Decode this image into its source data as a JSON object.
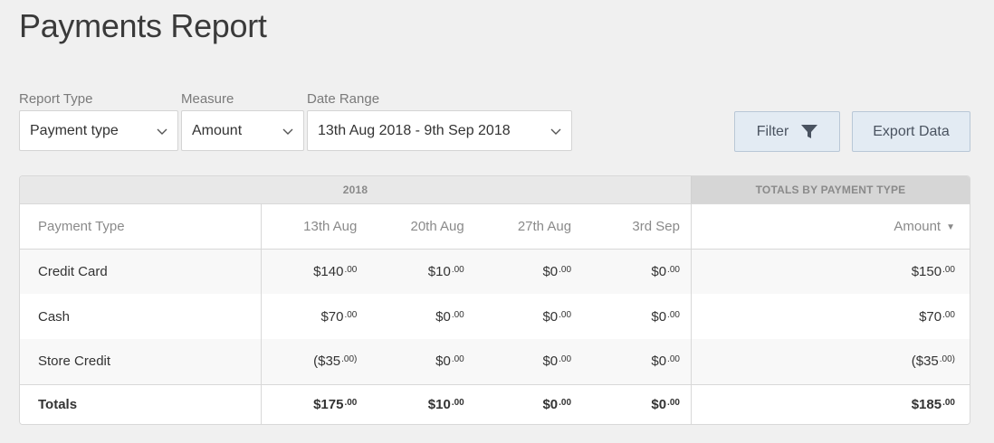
{
  "page": {
    "title": "Payments Report"
  },
  "controls": {
    "report_type": {
      "label": "Report Type",
      "value": "Payment type"
    },
    "measure": {
      "label": "Measure",
      "value": "Amount"
    },
    "date_range": {
      "label": "Date Range",
      "value": "13th Aug 2018 - 9th Sep 2018"
    },
    "filter_button": {
      "label": "Filter",
      "icon": "funnel-icon"
    },
    "export_button": {
      "label": "Export Data"
    }
  },
  "table": {
    "group_year": "2018",
    "group_totals": "TOTALS BY PAYMENT TYPE",
    "columns": {
      "name": "Payment Type",
      "weeks": [
        "13th Aug",
        "20th Aug",
        "27th Aug",
        "3rd Sep"
      ],
      "total": "Amount",
      "total_sort_icon": "sort-desc-icon"
    },
    "rows": [
      {
        "name": "Credit Card",
        "weeks": [
          {
            "main": "$140",
            "cents": ".00"
          },
          {
            "main": "$10",
            "cents": ".00"
          },
          {
            "main": "$0",
            "cents": ".00"
          },
          {
            "main": "$0",
            "cents": ".00"
          }
        ],
        "total": {
          "main": "$150",
          "cents": ".00"
        }
      },
      {
        "name": "Cash",
        "weeks": [
          {
            "main": "$70",
            "cents": ".00"
          },
          {
            "main": "$0",
            "cents": ".00"
          },
          {
            "main": "$0",
            "cents": ".00"
          },
          {
            "main": "$0",
            "cents": ".00"
          }
        ],
        "total": {
          "main": "$70",
          "cents": ".00"
        }
      },
      {
        "name": "Store Credit",
        "weeks": [
          {
            "main": "($35",
            "cents": ".00)"
          },
          {
            "main": "$0",
            "cents": ".00"
          },
          {
            "main": "$0",
            "cents": ".00"
          },
          {
            "main": "$0",
            "cents": ".00"
          }
        ],
        "total": {
          "main": "($35",
          "cents": ".00)"
        }
      }
    ],
    "totals": {
      "name": "Totals",
      "weeks": [
        {
          "main": "$175",
          "cents": ".00"
        },
        {
          "main": "$10",
          "cents": ".00"
        },
        {
          "main": "$0",
          "cents": ".00"
        },
        {
          "main": "$0",
          "cents": ".00"
        }
      ],
      "total": {
        "main": "$185",
        "cents": ".00"
      }
    }
  }
}
